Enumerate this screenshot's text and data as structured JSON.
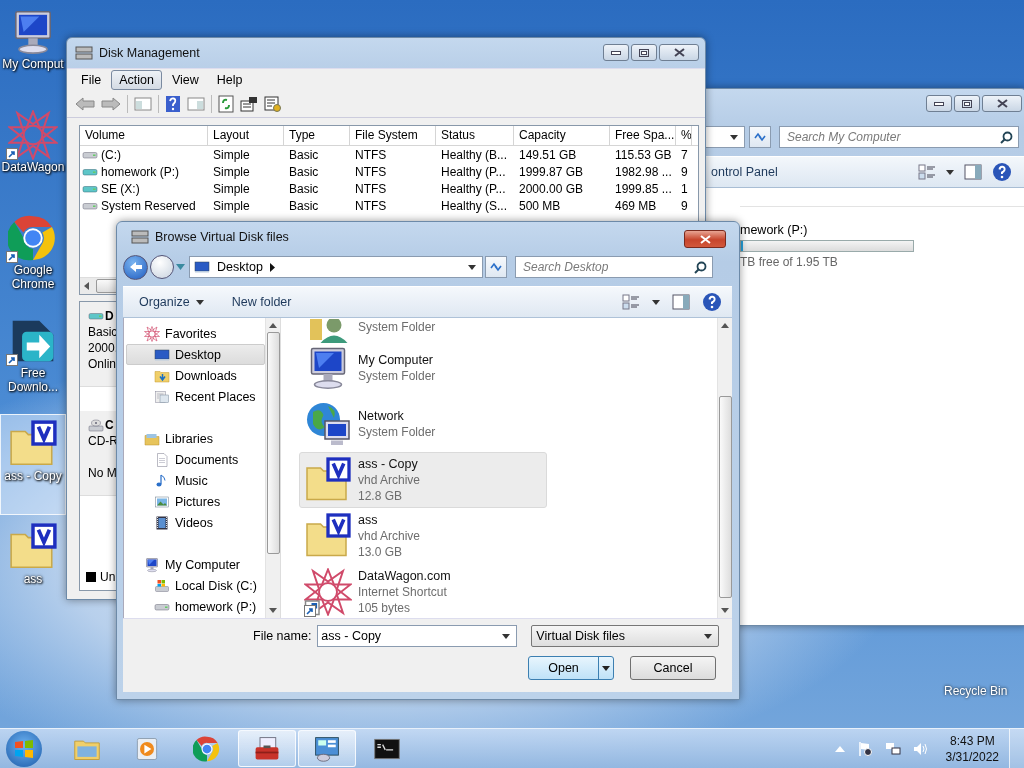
{
  "desktop": {
    "icons": [
      {
        "label": "My Comput",
        "kind": "computer",
        "shortcut": false,
        "selected": false
      },
      {
        "label": "DataWagon",
        "kind": "star",
        "shortcut": true,
        "selected": false
      },
      {
        "label": "Google Chrome",
        "kind": "chrome",
        "shortcut": true,
        "selected": false
      },
      {
        "label": "Free Downlo...",
        "kind": "download",
        "shortcut": true,
        "selected": false
      },
      {
        "label": "ass - Copy",
        "kind": "vhd",
        "shortcut": false,
        "selected": true
      },
      {
        "label": "ass",
        "kind": "vhd",
        "shortcut": false,
        "selected": false
      }
    ],
    "recycle_bin_label": "Recycle Bin"
  },
  "explorer_window": {
    "search_placeholder": "Search My Computer",
    "toolbar_item": "ontrol Panel",
    "drive": {
      "name": "mework (P:)",
      "level": 0.01,
      "free_text": "TB free of 1.95 TB"
    }
  },
  "disk_management": {
    "title": "Disk Management",
    "menu": [
      {
        "label": "File",
        "selected": false
      },
      {
        "label": "Action",
        "selected": true
      },
      {
        "label": "View",
        "selected": false
      },
      {
        "label": "Help",
        "selected": false
      }
    ],
    "table": {
      "columns": [
        "Volume",
        "Layout",
        "Type",
        "File System",
        "Status",
        "Capacity",
        "Free Spa...",
        "%"
      ],
      "rows": [
        {
          "kind": "system",
          "cells": [
            "(C:)",
            "Simple",
            "Basic",
            "NTFS",
            "Healthy (B...",
            "149.51 GB",
            "115.53 GB",
            "7"
          ]
        },
        {
          "kind": "data",
          "cells": [
            "homework (P:)",
            "Simple",
            "Basic",
            "NTFS",
            "Healthy (P...",
            "1999.87 GB",
            "1982.98 ...",
            "9"
          ]
        },
        {
          "kind": "data",
          "cells": [
            "SE (X:)",
            "Simple",
            "Basic",
            "NTFS",
            "Healthy (P...",
            "2000.00 GB",
            "1999.85 ...",
            "1"
          ]
        },
        {
          "kind": "system",
          "cells": [
            "System Reserved",
            "Simple",
            "Basic",
            "NTFS",
            "Healthy (S...",
            "500 MB",
            "469 MB",
            "9"
          ]
        }
      ]
    },
    "disks": [
      {
        "kind": "disk",
        "name": "D",
        "lines": [
          "Basic",
          "2000.",
          "Onlin"
        ]
      },
      {
        "kind": "cdrom",
        "name": "C",
        "lines": [
          "CD-R",
          "No M"
        ]
      }
    ],
    "legend": "Un"
  },
  "dialog": {
    "title": "Browse Virtual Disk files",
    "address": "Desktop",
    "search_placeholder": "Search Desktop",
    "toolbar": [
      {
        "label": "Organize",
        "menu": true
      },
      {
        "label": "New folder",
        "menu": false
      }
    ],
    "nav": [
      {
        "label": "Favorites",
        "kind": "star",
        "selected": false,
        "children": [
          {
            "label": "Desktop",
            "kind": "desktop",
            "selected": true
          },
          {
            "label": "Downloads",
            "kind": "downloads",
            "selected": false
          },
          {
            "label": "Recent Places",
            "kind": "recent",
            "selected": false
          }
        ]
      },
      {
        "label": "Libraries",
        "kind": "library",
        "selected": false,
        "children": [
          {
            "label": "Documents",
            "kind": "document",
            "selected": false
          },
          {
            "label": "Music",
            "kind": "music",
            "selected": false
          },
          {
            "label": "Pictures",
            "kind": "pictures",
            "selected": false
          },
          {
            "label": "Videos",
            "kind": "videos",
            "selected": false
          }
        ]
      },
      {
        "label": "My Computer",
        "kind": "computer",
        "selected": false,
        "children": [
          {
            "label": "Local Disk (C:)",
            "kind": "localdisk",
            "selected": false
          },
          {
            "label": "homework (P:)",
            "kind": "drive",
            "selected": false
          }
        ]
      }
    ],
    "files": [
      {
        "kind": "user",
        "details": [
          "System Folder"
        ],
        "selected": false
      },
      {
        "name": "My Computer",
        "kind": "computer",
        "details": [
          "System Folder"
        ],
        "selected": false
      },
      {
        "name": "Network",
        "kind": "network",
        "details": [
          "System Folder"
        ],
        "selected": false
      },
      {
        "name": "ass - Copy",
        "kind": "vhd",
        "details": [
          "vhd Archive",
          "12.8 GB"
        ],
        "selected": true
      },
      {
        "name": "ass",
        "kind": "vhd",
        "details": [
          "vhd Archive",
          "13.0 GB"
        ],
        "selected": false
      },
      {
        "name": "DataWagon.com",
        "kind": "star-shortcut",
        "details": [
          "Internet Shortcut",
          "105 bytes"
        ],
        "selected": false
      }
    ],
    "file_name_label": "File name:",
    "file_name": "ass - Copy",
    "file_type": "Virtual Disk files",
    "buttons": [
      {
        "label": "Open",
        "kind": "split",
        "default": true
      },
      {
        "label": "Cancel",
        "kind": "plain",
        "default": false
      }
    ]
  },
  "taskbar": {
    "items": [
      {
        "kind": "folder",
        "active": false
      },
      {
        "kind": "media",
        "active": false
      },
      {
        "kind": "chrome",
        "active": false
      },
      {
        "kind": "toolbox",
        "active": true
      },
      {
        "kind": "panel",
        "active": true
      },
      {
        "kind": "cmd",
        "active": false
      }
    ],
    "time": "8:43 PM",
    "date": "3/31/2022"
  }
}
